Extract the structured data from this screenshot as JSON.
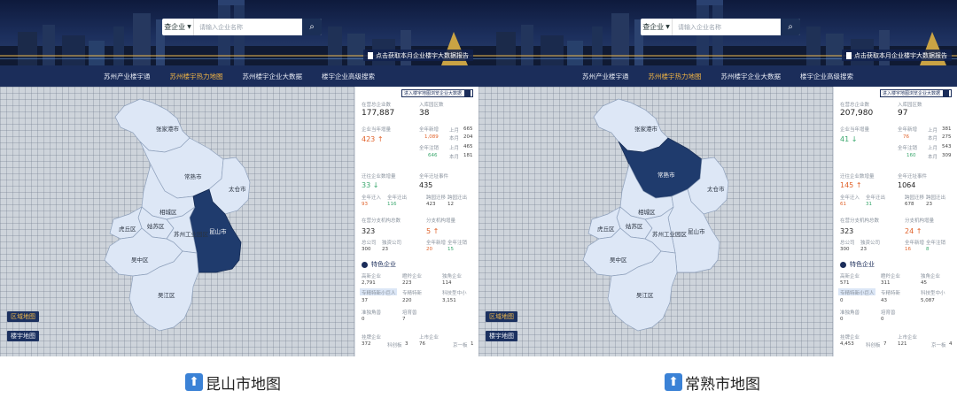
{
  "header": {
    "search_select": "查企业",
    "search_placeholder": "请输入企业名称",
    "report_link": "点击获取本月企业楼宇大数据报告"
  },
  "nav": {
    "items": [
      "苏州产业楼宇通",
      "苏州楼宇热力地图",
      "苏州楼宇企业大数据",
      "楼宇企业高级搜索"
    ]
  },
  "map_buttons": {
    "region": "区域地图",
    "building": "楼宇地图"
  },
  "regions": {
    "zjg": "张家港市",
    "cs": "常熟市",
    "tc": "太仓市",
    "xc": "相城区",
    "ks": "昆山市",
    "gs": "姑苏区",
    "sip": "苏州工业园区",
    "hq": "虎丘区",
    "wz": "吴中区",
    "wj": "吴江区"
  },
  "panel_labels": {
    "enter_link": "进入楼宇地图浏览企业大数据",
    "reg_total": "在营总企业数",
    "park": "入库园区数",
    "new_this_month": "企业当年增量",
    "y_new": "全年新增",
    "y_cancel": "全年注销",
    "last_month": "上月",
    "this_month": "本月",
    "move_in": "迁往企业数增量",
    "events": "全年迁址事件",
    "in_sub": "全年迁入",
    "out_sub": "全年迁出",
    "in_sub2": "跨园迁移",
    "out_sub2": "跨园迁出",
    "branch": "在营分支机构总数",
    "branch_new": "分支机构增量",
    "sub_a": "总公司",
    "sub_b": "独资公司",
    "sub_c": "全年新增",
    "sub_d": "全年注销",
    "special_title": "特色企业",
    "sp1": "高新企业",
    "sp2": "瞪羚企业",
    "sp3": "独角企业",
    "sp4": "专精特新小巨人",
    "sp5": "专精特新",
    "sp6": "科技型中小",
    "sp7": "准独角兽",
    "sp8": "培育兽",
    "listed": "挂牌企业",
    "listed2": "上市企业",
    "board_a": "科创板",
    "board_b": "新三板",
    "board_c": "京一板"
  },
  "left_panel": {
    "reg_total": "177,887",
    "park": "38",
    "new_this_month": "423",
    "y_new": "1,089",
    "y_cancel": "646",
    "m_last_a": "665",
    "m_this_a": "204",
    "m_last_b": "465",
    "m_this_b": "181",
    "move_in": "33",
    "events": "435",
    "in_a": "93",
    "out_a": "116",
    "in_b": "423",
    "out_b": "12",
    "branch": "323",
    "branch_new": "5",
    "sub_a": "300",
    "sub_b": "23",
    "sub_c": "20",
    "sub_d": "15",
    "sp1": "2,791",
    "sp2": "223",
    "sp3": "114",
    "sp4": "37",
    "sp5": "220",
    "sp6": "3,151",
    "sp7": "0",
    "sp8": "7",
    "listed": "372",
    "board_a_v": "3",
    "listed2": "76",
    "board_c_v": "1"
  },
  "right_panel": {
    "reg_total": "207,980",
    "park": "97",
    "new_this_month": "41",
    "y_new": "76",
    "y_cancel": "160",
    "m_last_a": "381",
    "m_this_a": "275",
    "m_last_b": "543",
    "m_this_b": "309",
    "move_in": "145",
    "events": "1064",
    "in_a": "61",
    "out_a": "31",
    "in_b": "678",
    "out_b": "23",
    "branch": "323",
    "branch_new": "24",
    "sub_a": "300",
    "sub_b": "23",
    "sub_c": "16",
    "sub_d": "8",
    "sp1": "571",
    "sp2": "311",
    "sp3": "45",
    "sp4": "0",
    "sp5": "43",
    "sp6": "5,087",
    "sp7": "0",
    "sp8": "0",
    "listed": "4,453",
    "board_a_v": "7",
    "listed2": "121",
    "board_c_v": "4"
  },
  "captions": {
    "left": "昆山市地图",
    "right": "常熟市地图",
    "arrow": "⬆"
  },
  "colors": {
    "accent": "#f2b544",
    "nav_bg": "#1b2d5a",
    "active_region": "#1f3b6d",
    "region_fill": "#dde7f6",
    "increase": "#e0622a",
    "decrease": "#3aa76d"
  }
}
